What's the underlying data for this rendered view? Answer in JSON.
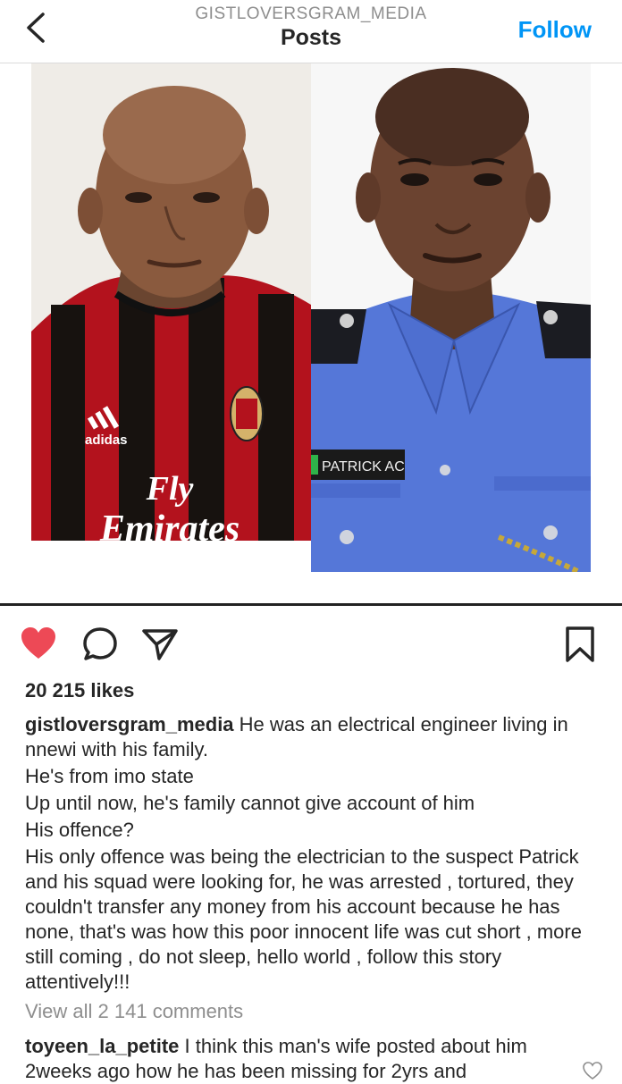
{
  "header": {
    "account": "GISTLOVERSGRAM_MEDIA",
    "title": "Posts",
    "follow_label": "Follow"
  },
  "post": {
    "photo_left": {
      "jersey_text": "Fly Emirates",
      "brand": "adidas"
    },
    "photo_right": {
      "name_tag": "PATRICK AC"
    },
    "likes": "20 215 likes",
    "caption": {
      "username": "gistloversgram_media",
      "lines": [
        "He was an electrical engineer living in nnewi with his family.",
        "He's from imo state",
        "Up until now, he's family cannot give account of him",
        "His  offence?",
        "His only offence was being the electrician to the suspect Patrick and his squad  were looking for, he was arrested , tortured, they couldn't transfer any money from his account because he has none, that's  was how this poor innocent life was cut short , more still coming , do not sleep, hello world , follow this story attentively!!!"
      ]
    },
    "view_all_comments": "View all 2 141 comments",
    "comment": {
      "username": "toyeen_la_petite",
      "text": "I think this man's wife posted about him 2weeks ago how he has been missing for 2yrs and"
    }
  },
  "icons": {
    "back": "chevron-left-icon",
    "like": "heart-filled-icon",
    "comment": "comment-bubble-icon",
    "share": "paper-plane-icon",
    "save": "bookmark-icon"
  },
  "colors": {
    "accent": "#0095f6",
    "like": "#ed4956",
    "muted": "#8e8e8e"
  }
}
